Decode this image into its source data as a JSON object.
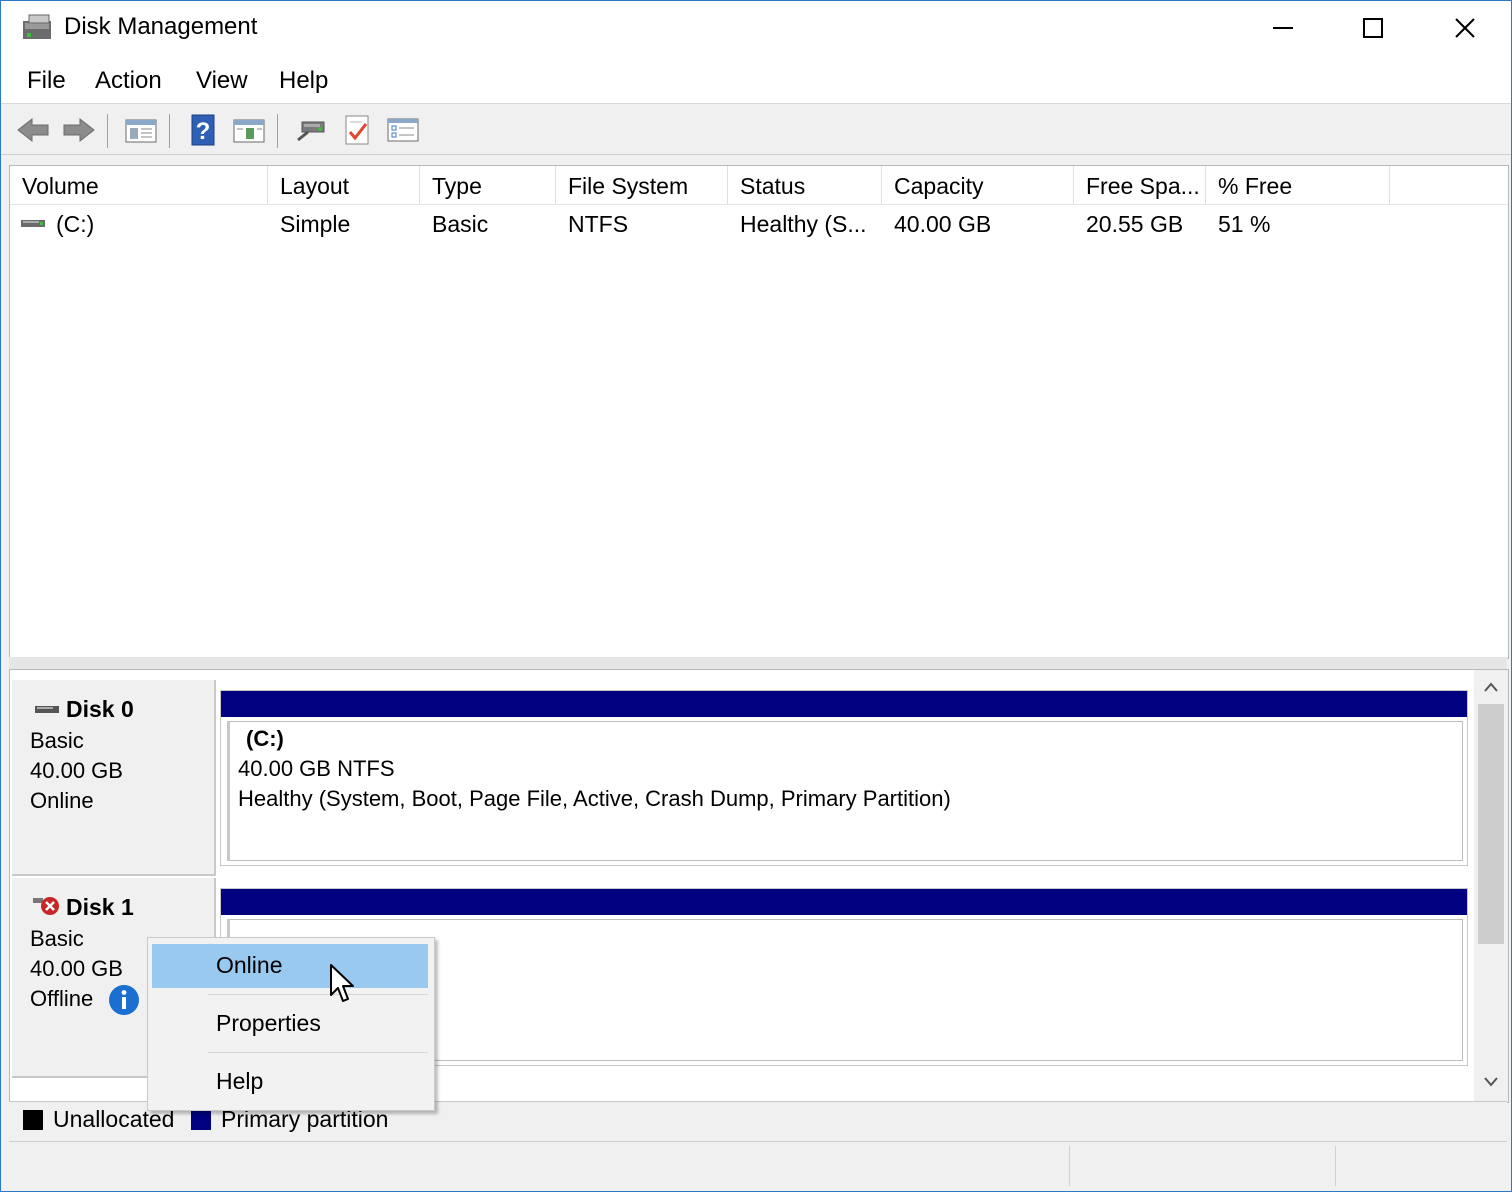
{
  "window": {
    "title": "Disk Management"
  },
  "menu": [
    "File",
    "Action",
    "View",
    "Help"
  ],
  "toolbar": [
    "back-icon",
    "forward-icon",
    "console-tree-icon",
    "help-icon",
    "show-pane-icon",
    "connect-icon",
    "check-icon",
    "properties-icon"
  ],
  "volume_list": {
    "columns": [
      "Volume",
      "Layout",
      "Type",
      "File System",
      "Status",
      "Capacity",
      "Free Spa...",
      "% Free"
    ],
    "rows": [
      {
        "volume": "(C:)",
        "layout": "Simple",
        "type": "Basic",
        "fs": "NTFS",
        "status": "Healthy (S...",
        "capacity": "40.00 GB",
        "free": "20.55 GB",
        "pct": "51 %"
      }
    ]
  },
  "disks": [
    {
      "name": "Disk 0",
      "kind": "Basic",
      "size": "40.00 GB",
      "state": "Online",
      "volume": {
        "label": "(C:)",
        "desc": "40.00 GB NTFS",
        "status": "Healthy (System, Boot, Page File, Active, Crash Dump, Primary Partition)"
      }
    },
    {
      "name": "Disk 1",
      "kind": "Basic",
      "size": "40.00 GB",
      "state": "Offline"
    }
  ],
  "context_menu": {
    "items": [
      "Online",
      "Properties",
      "Help"
    ],
    "highlighted": "Online"
  },
  "legend": [
    {
      "label": "Unallocated",
      "color": "#000000"
    },
    {
      "label": "Primary partition",
      "color": "#000080"
    }
  ],
  "colors": {
    "primary_partition": "#000080",
    "menu_highlight": "#99c9ef",
    "window_border": "#2b77c8"
  }
}
